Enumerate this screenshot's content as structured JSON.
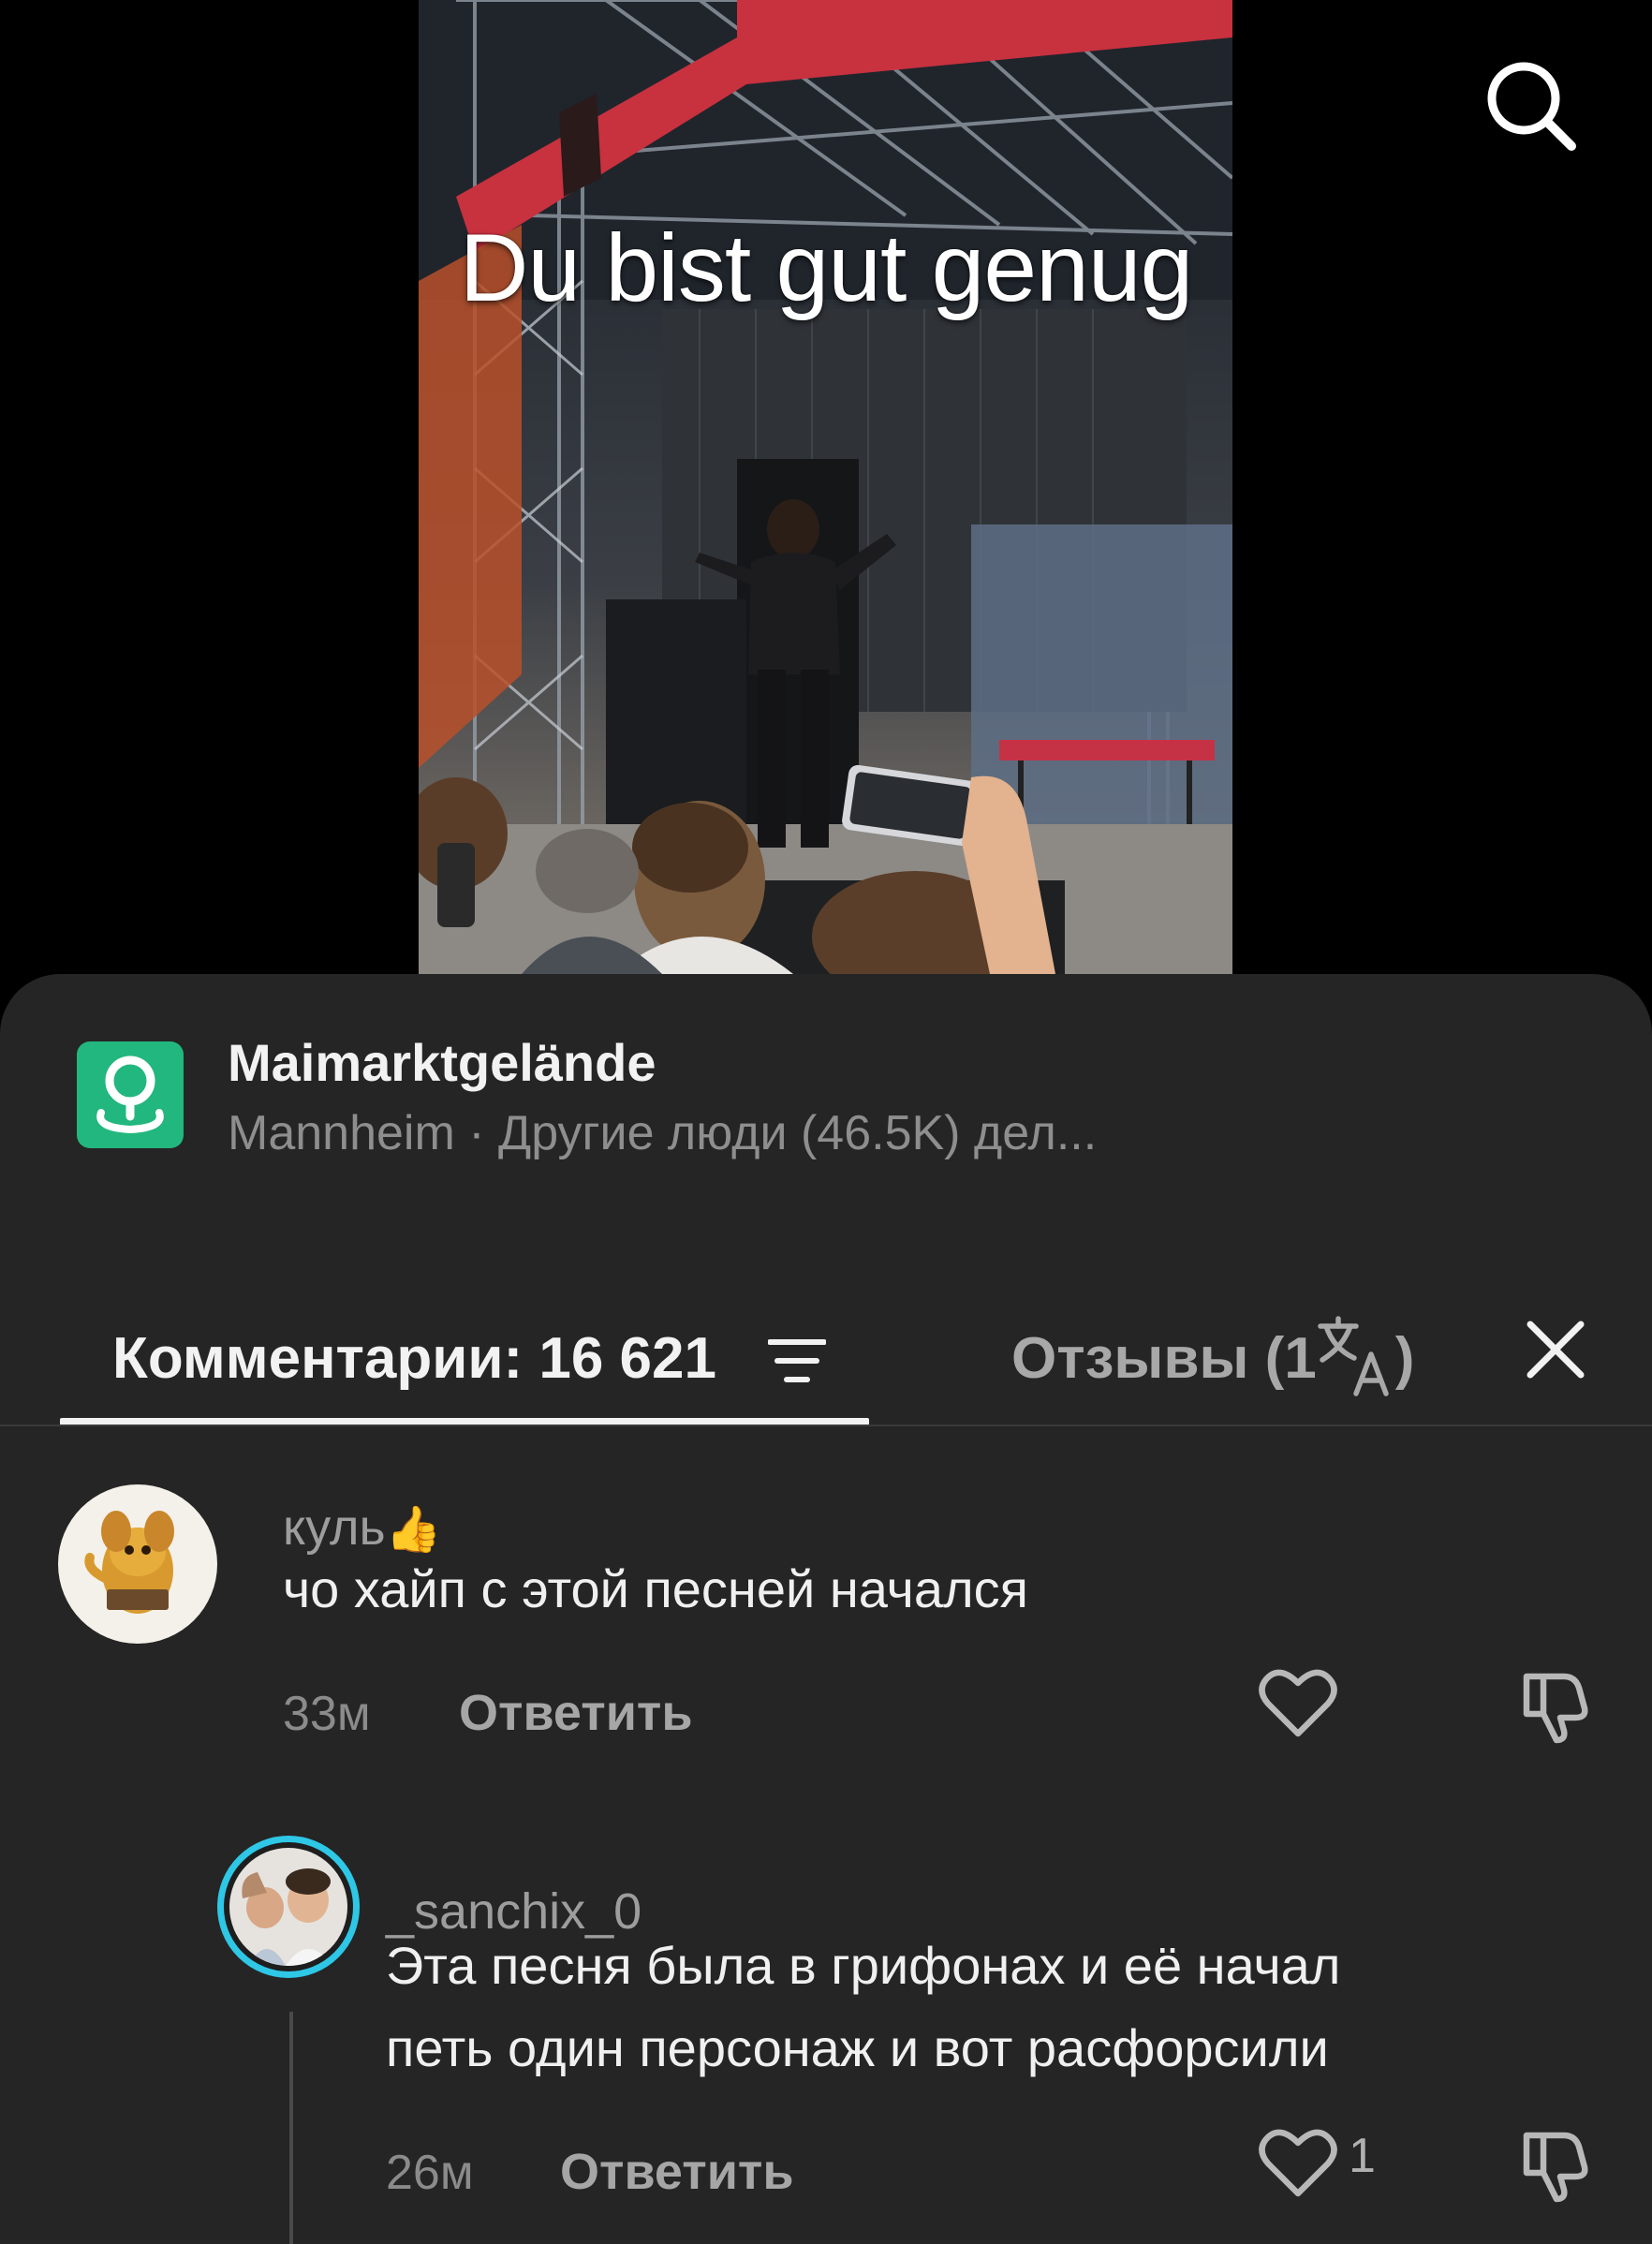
{
  "video": {
    "overlay_text": "Du bist gut genug"
  },
  "location": {
    "name": "Maimarktgelände",
    "subtitle": "Mannheim · Другие люди (46.5K) дел..."
  },
  "tabs": {
    "comments_label": "Комментарии: 16 621",
    "reviews_label": "Отзывы (1",
    "reviews_suffix": ")"
  },
  "comments": [
    {
      "username": "куль",
      "badge": "👍",
      "text": "чо хайп с этой песней начался",
      "time": "33м",
      "reply_label": "Ответить",
      "likes": ""
    },
    {
      "username": "_sanchix_0",
      "text_line1": "Эта песня была в грифонах и её начал",
      "text_line2": "петь один персонаж и вот расфорсили",
      "time": "26м",
      "reply_label": "Ответить",
      "likes": "1"
    }
  ],
  "colors": {
    "sheet_bg": "#252525",
    "location_icon": "#22b77e",
    "avatar_ring": "#2ec7e6"
  }
}
